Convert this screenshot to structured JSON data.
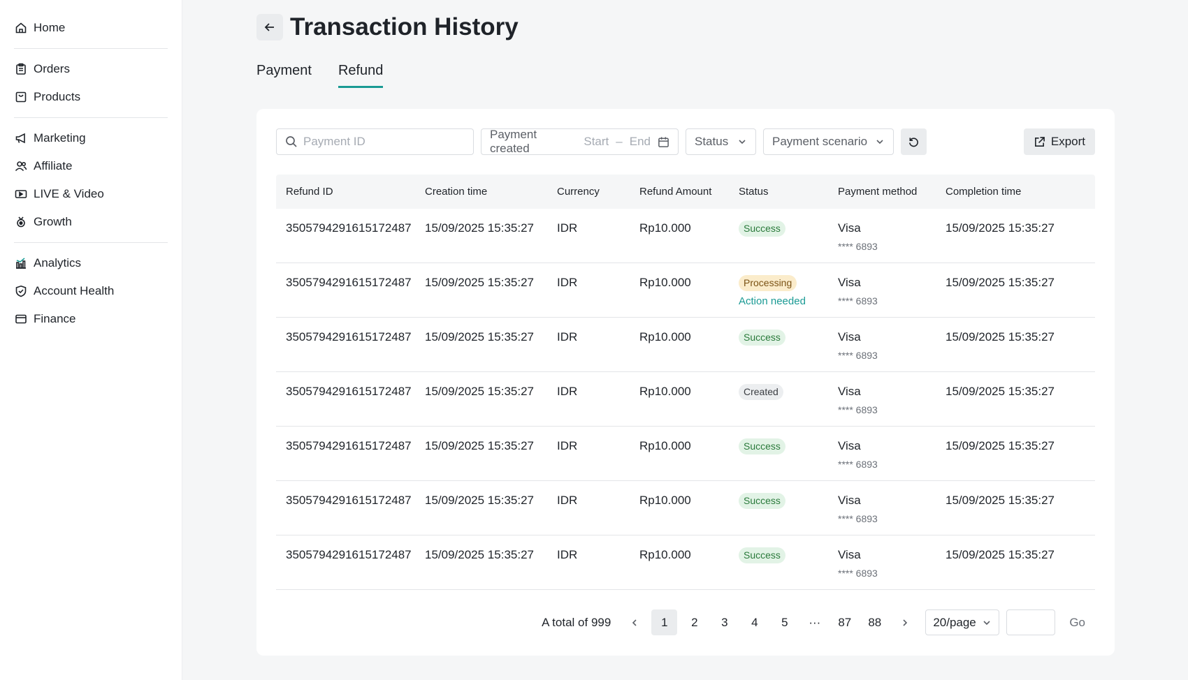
{
  "sidebar": {
    "items": [
      {
        "label": "Home",
        "icon": "home-icon"
      },
      {
        "label": "Orders",
        "icon": "clipboard-icon"
      },
      {
        "label": "Products",
        "icon": "bag-icon"
      },
      {
        "label": "Marketing",
        "icon": "megaphone-icon"
      },
      {
        "label": "Affiliate",
        "icon": "users-icon"
      },
      {
        "label": "LIVE & Video",
        "icon": "video-icon"
      },
      {
        "label": "Growth",
        "icon": "medal-icon"
      },
      {
        "label": "Analytics",
        "icon": "bar-chart-icon"
      },
      {
        "label": "Account Health",
        "icon": "shield-icon"
      },
      {
        "label": "Finance",
        "icon": "wallet-icon"
      }
    ]
  },
  "header": {
    "title": "Transaction History"
  },
  "tabs": [
    {
      "label": "Payment",
      "active": false
    },
    {
      "label": "Refund",
      "active": true
    }
  ],
  "filters": {
    "search_placeholder": "Payment ID",
    "date_label": "Payment created",
    "date_start": "Start",
    "date_sep": "–",
    "date_end": "End",
    "status_label": "Status",
    "scenario_label": "Payment scenario",
    "export_label": "Export"
  },
  "table": {
    "headers": [
      "Refund ID",
      "Creation time",
      "Currency",
      "Refund Amount",
      "Status",
      "Payment method",
      "Completion time"
    ],
    "rows": [
      {
        "id": "3505794291615172487",
        "created": "15/09/2025 15:35:27",
        "currency": "IDR",
        "amount": "Rp10.000",
        "status": "Success",
        "status_type": "success",
        "action": "",
        "method": "Visa",
        "card": "**** 6893",
        "completed": "15/09/2025 15:35:27"
      },
      {
        "id": "3505794291615172487",
        "created": "15/09/2025 15:35:27",
        "currency": "IDR",
        "amount": "Rp10.000",
        "status": "Processing",
        "status_type": "processing",
        "action": "Action needed",
        "method": "Visa",
        "card": "**** 6893",
        "completed": "15/09/2025 15:35:27"
      },
      {
        "id": "3505794291615172487",
        "created": "15/09/2025 15:35:27",
        "currency": "IDR",
        "amount": "Rp10.000",
        "status": "Success",
        "status_type": "success",
        "action": "",
        "method": "Visa",
        "card": "**** 6893",
        "completed": "15/09/2025 15:35:27"
      },
      {
        "id": "3505794291615172487",
        "created": "15/09/2025 15:35:27",
        "currency": "IDR",
        "amount": "Rp10.000",
        "status": "Created",
        "status_type": "created",
        "action": "",
        "method": "Visa",
        "card": "**** 6893",
        "completed": "15/09/2025 15:35:27"
      },
      {
        "id": "3505794291615172487",
        "created": "15/09/2025 15:35:27",
        "currency": "IDR",
        "amount": "Rp10.000",
        "status": "Success",
        "status_type": "success",
        "action": "",
        "method": "Visa",
        "card": "**** 6893",
        "completed": "15/09/2025 15:35:27"
      },
      {
        "id": "3505794291615172487",
        "created": "15/09/2025 15:35:27",
        "currency": "IDR",
        "amount": "Rp10.000",
        "status": "Success",
        "status_type": "success",
        "action": "",
        "method": "Visa",
        "card": "**** 6893",
        "completed": "15/09/2025 15:35:27"
      },
      {
        "id": "3505794291615172487",
        "created": "15/09/2025 15:35:27",
        "currency": "IDR",
        "amount": "Rp10.000",
        "status": "Success",
        "status_type": "success",
        "action": "",
        "method": "Visa",
        "card": "**** 6893",
        "completed": "15/09/2025 15:35:27"
      }
    ]
  },
  "pagination": {
    "total": "A total of 999",
    "pages": [
      "1",
      "2",
      "3",
      "4",
      "5",
      "···",
      "87",
      "88"
    ],
    "current": "1",
    "page_size": "20/page",
    "go_label": "Go"
  },
  "colors": {
    "accent": "#1a9a94",
    "success_bg": "#e2f3e6",
    "success_text": "#2a7a3b",
    "processing_bg": "#fbeccb",
    "processing_text": "#7a5214",
    "created_bg": "#eceef0"
  }
}
